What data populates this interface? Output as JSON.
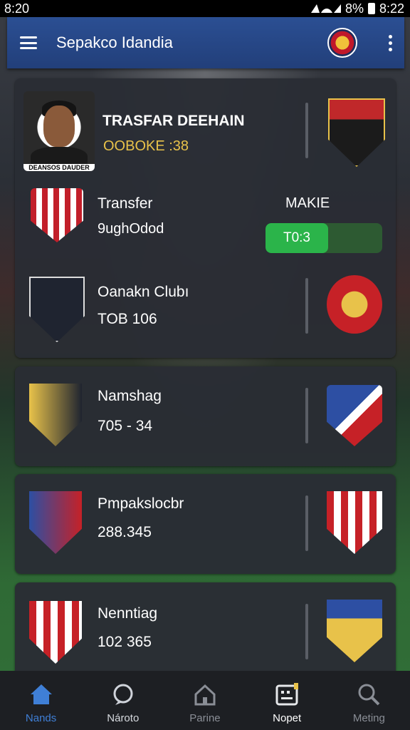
{
  "status_bar": {
    "time": "8:20",
    "battery": "8%",
    "clock": "8:22"
  },
  "app_bar": {
    "title": "Sepakco Idandia"
  },
  "featured": {
    "player_caption": "DEANSOS DAUDER",
    "title": "TRASFAR DEEHAIN",
    "subtitle": "OOBOKE :38",
    "transfer_label": "Transfer",
    "transfer_value": "9ughOdod",
    "make_label": "MAKIE",
    "toggle_value": "T0:3"
  },
  "rows": [
    {
      "name": "Oanakn Clubı",
      "value": "TOB 106"
    },
    {
      "name": "Namshag",
      "value": "705 - 34"
    },
    {
      "name": "Pmpakslocbr",
      "value": "288.345"
    },
    {
      "name": "Nenntiag",
      "value": "102 365"
    }
  ],
  "nav": [
    {
      "label": "Nands",
      "icon": "home-icon",
      "active": true
    },
    {
      "label": "Nároto",
      "icon": "chat-icon",
      "active": false
    },
    {
      "label": "Parine",
      "icon": "house-outline-icon",
      "active": false
    },
    {
      "label": "Nopet",
      "icon": "report-icon",
      "active": false,
      "bright": true
    },
    {
      "label": "Meting",
      "icon": "search-icon",
      "active": false
    }
  ],
  "colors": {
    "accent": "#2bb44a",
    "appbar": "#2b4f93",
    "nav_active": "#3f7fd6",
    "gold": "#e8c24a"
  }
}
